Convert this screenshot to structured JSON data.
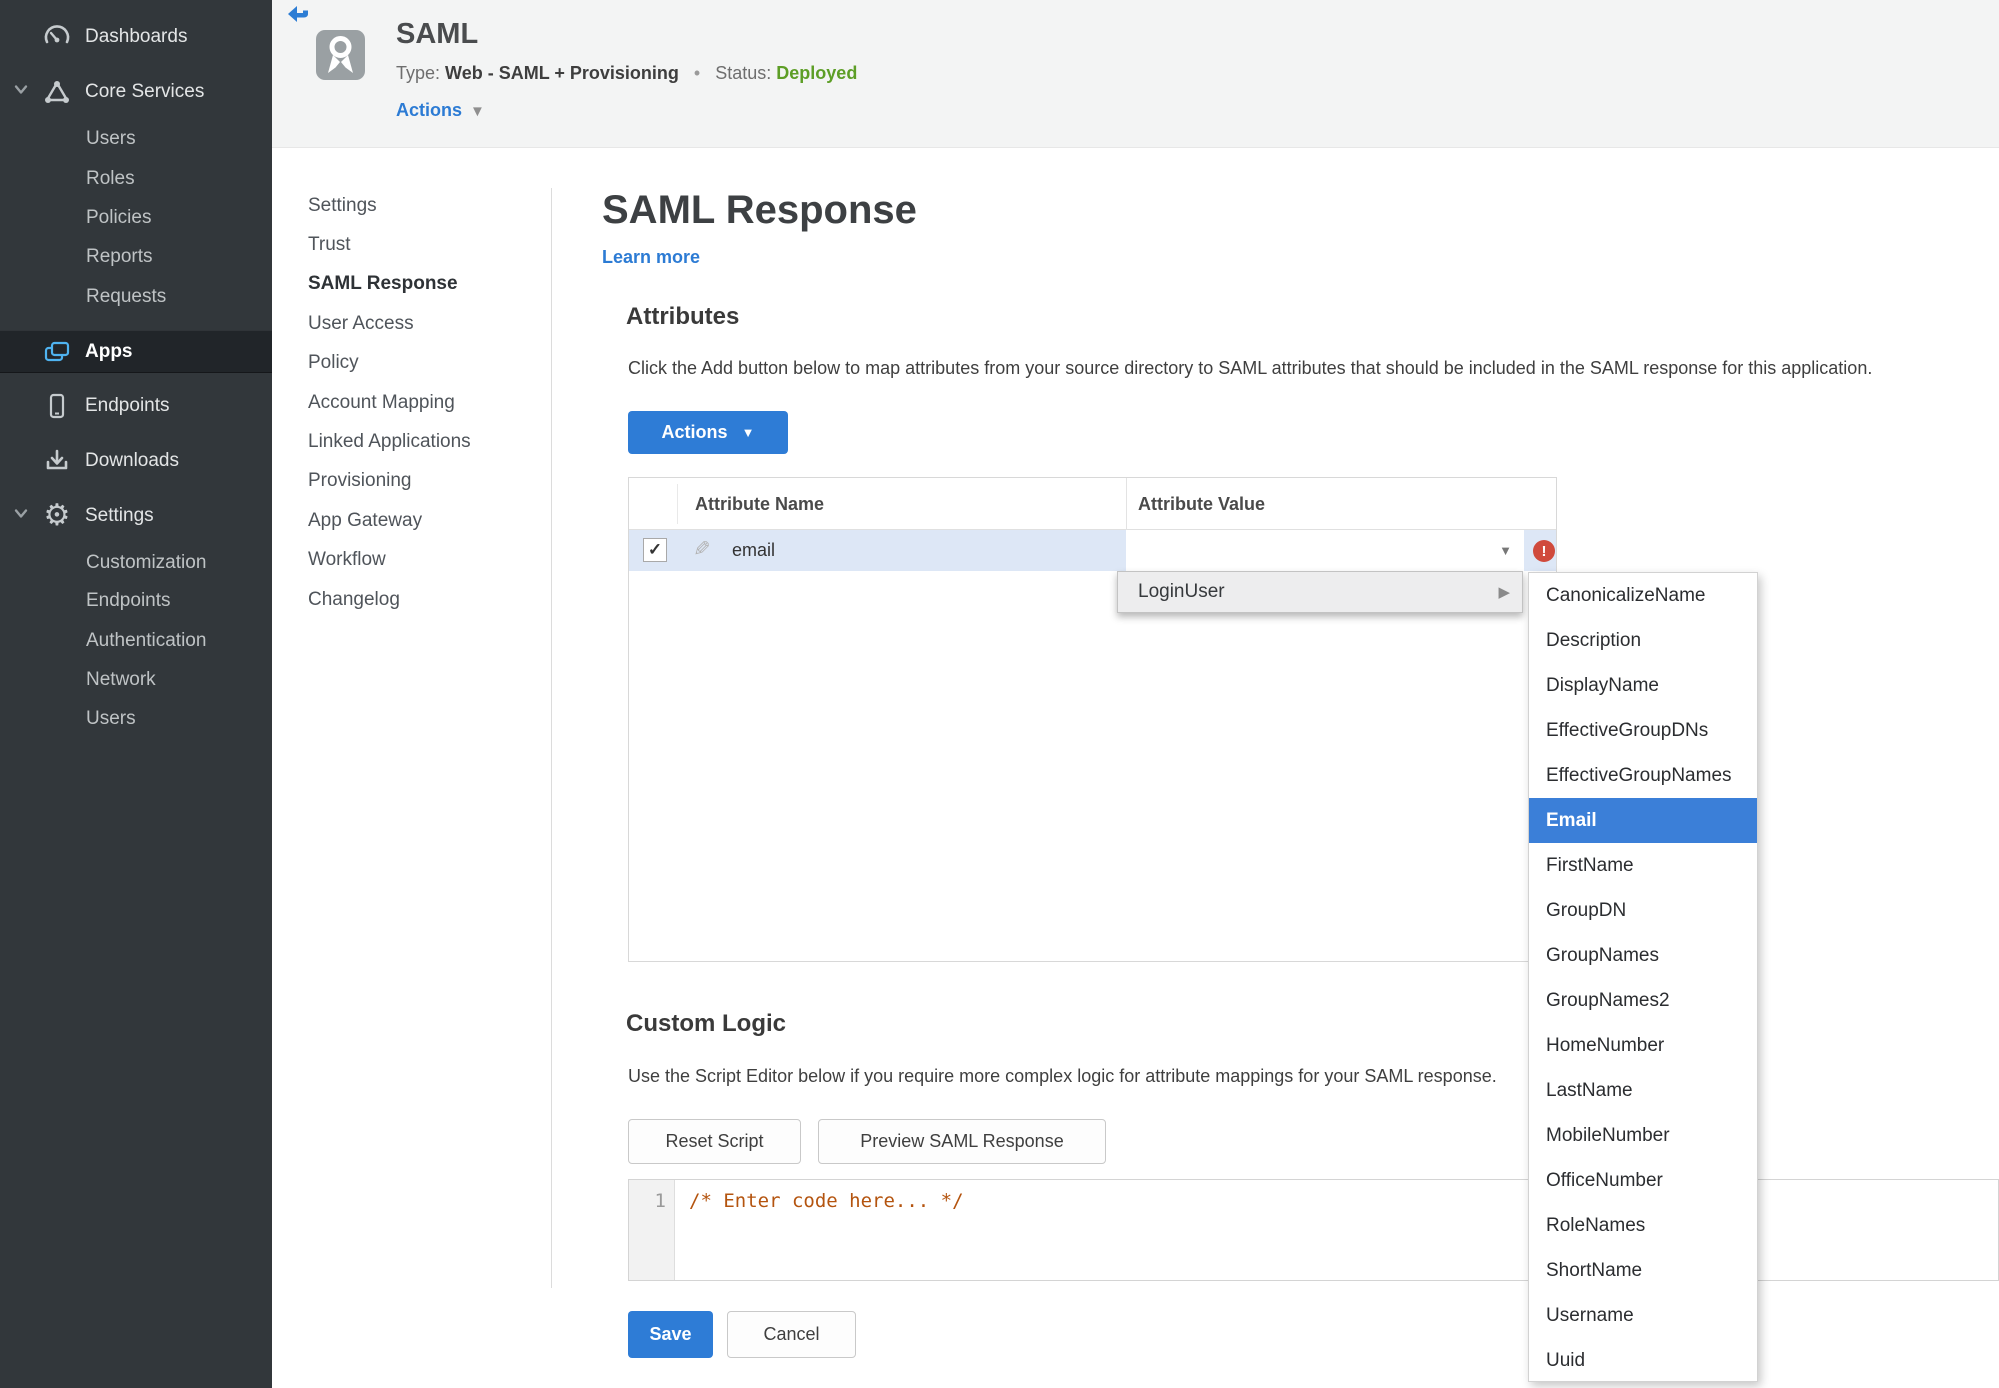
{
  "sidebar": {
    "items": [
      {
        "label": "Dashboards",
        "icon": "gauge"
      },
      {
        "label": "Core Services",
        "icon": "core-services"
      },
      {
        "label": "Users"
      },
      {
        "label": "Roles"
      },
      {
        "label": "Policies"
      },
      {
        "label": "Reports"
      },
      {
        "label": "Requests"
      },
      {
        "label": "Apps",
        "icon": "apps",
        "active": true
      },
      {
        "label": "Endpoints",
        "icon": "smartphone"
      },
      {
        "label": "Downloads",
        "icon": "download"
      },
      {
        "label": "Settings",
        "icon": "gear"
      },
      {
        "label": "Customization"
      },
      {
        "label": "Endpoints"
      },
      {
        "label": "Authentication"
      },
      {
        "label": "Network"
      },
      {
        "label": "Users"
      }
    ]
  },
  "header": {
    "title": "SAML",
    "type_label": "Type:",
    "type_value": "Web - SAML + Provisioning",
    "separator": "•",
    "status_label": "Status:",
    "status_value": "Deployed",
    "actions_label": "Actions"
  },
  "subnav": {
    "items": [
      "Settings",
      "Trust",
      "SAML Response",
      "User Access",
      "Policy",
      "Account Mapping",
      "Linked Applications",
      "Provisioning",
      "App Gateway",
      "Workflow",
      "Changelog"
    ],
    "active": "SAML Response"
  },
  "main": {
    "title": "SAML Response",
    "learn_more": "Learn more",
    "attributes": {
      "heading": "Attributes",
      "description": "Click the Add button below to map attributes from your source directory to SAML attributes that should be included in the SAML response for this application.",
      "actions_button": "Actions",
      "table": {
        "columns": [
          "Attribute Name",
          "Attribute Value"
        ],
        "row": {
          "name": "email",
          "checked": "✓",
          "value": ""
        }
      }
    },
    "custom_logic": {
      "heading": "Custom Logic",
      "description": "Use the Script Editor below if you require more complex logic for attribute mappings for your SAML response.",
      "reset_button": "Reset Script",
      "preview_button": "Preview SAML Response",
      "editor": {
        "line_number": "1",
        "code": "/* Enter code here... */"
      }
    },
    "save_button": "Save",
    "cancel_button": "Cancel"
  },
  "dropdown": {
    "trigger": "LoginUser",
    "selected": "Email",
    "items": [
      "CanonicalizeName",
      "Description",
      "DisplayName",
      "EffectiveGroupDNs",
      "EffectiveGroupNames",
      "Email",
      "FirstName",
      "GroupDN",
      "GroupNames",
      "GroupNames2",
      "HomeNumber",
      "LastName",
      "MobileNumber",
      "OfficeNumber",
      "RoleNames",
      "ShortName",
      "Username",
      "Uuid"
    ]
  },
  "colors": {
    "accent_blue": "#2e7cd6",
    "link_blue": "#2c7bd4",
    "status_green": "#5d9e26",
    "error_red": "#d04a3c",
    "menu_highlight_blue": "#3b7fd8",
    "row_highlight_blue": "#dde7f6",
    "sidebar_bg": "#32373b",
    "header_bg": "#f3f4f4",
    "code_comment_orange": "#b4540f",
    "apps_icon_blue": "#4fb3f0"
  }
}
